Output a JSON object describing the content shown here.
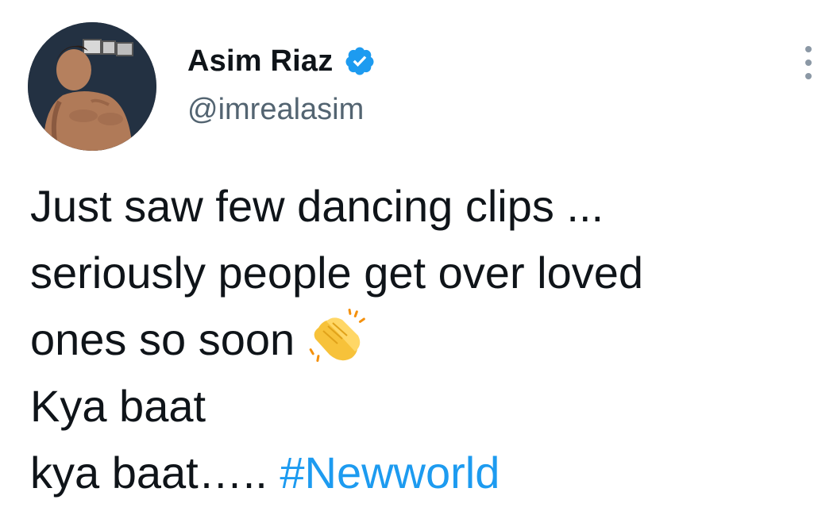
{
  "tweet": {
    "author": {
      "display_name": "Asim Riaz",
      "handle": "@imrealasim",
      "verified": true,
      "avatar_icon": "profile-photo"
    },
    "more_icon": "more-options-icon",
    "text_lines": [
      "Just saw few dancing clips ...",
      "seriously people get over loved",
      "ones so soon",
      "Kya baat",
      "kya baat….. "
    ],
    "hashtag": "#Newworld",
    "emoji": "clapping-hands-emoji"
  },
  "colors": {
    "text": "#0f1419",
    "secondary": "#536471",
    "accent": "#1d9bf0"
  }
}
